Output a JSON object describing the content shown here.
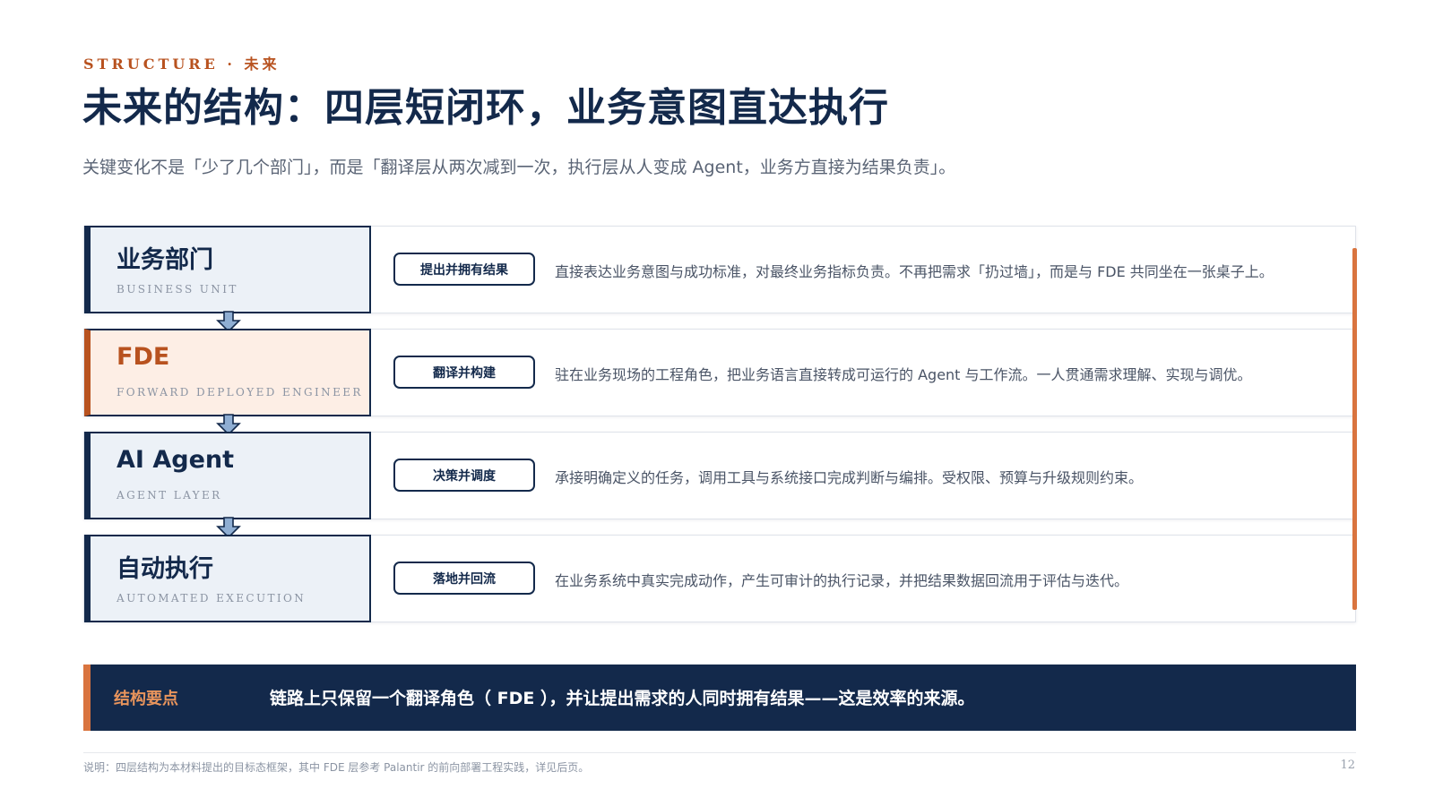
{
  "header": {
    "eyebrow": "STRUCTURE · 未来",
    "title": "未来的结构：四层短闭环，业务意图直达执行",
    "subtitle": "关键变化不是「少了几个部门」，而是「翻译层从两次减到一次，执行层从人变成 Agent，业务方直接为结果负责」。"
  },
  "layers": [
    {
      "name": "业务部门",
      "sub": "BUSINESS UNIT",
      "tag": "提出并拥有结果",
      "desc": "直接表达业务意图与成功标准，对最终业务指标负责。不再把需求「扔过墙」，而是与 FDE 共同坐在一张桌子上。"
    },
    {
      "name": "FDE",
      "sub": "FORWARD DEPLOYED ENGINEER",
      "tag": "翻译并构建",
      "desc": "驻在业务现场的工程角色，把业务语言直接转成可运行的 Agent 与工作流。一人贯通需求理解、实现与调优。"
    },
    {
      "name": "AI Agent",
      "sub": "AGENT LAYER",
      "tag": "决策并调度",
      "desc": "承接明确定义的任务，调用工具与系统接口完成判断与编排。受权限、预算与升级规则约束。"
    },
    {
      "name": "自动执行",
      "sub": "AUTOMATED EXECUTION",
      "tag": "落地并回流",
      "desc": "在业务系统中真实完成动作，产生可审计的执行记录，并把结果数据回流用于评估与迭代。"
    }
  ],
  "keypoint": {
    "label": "结构要点",
    "text": "链路上只保留一个翻译角色（ FDE ），并让提出需求的人同时拥有结果——这是效率的来源。"
  },
  "footer": {
    "note": "说明：四层结构为本材料提出的目标态框架，其中 FDE 层参考 Palantir 的前向部署工程实践，详见后页。",
    "page": "12"
  },
  "colors": {
    "navy": "#13294b",
    "accent": "#b8521f",
    "accent_light": "#d9743f",
    "layer_bg": "#ecf1f7",
    "fde_bg": "#fdeee5"
  }
}
